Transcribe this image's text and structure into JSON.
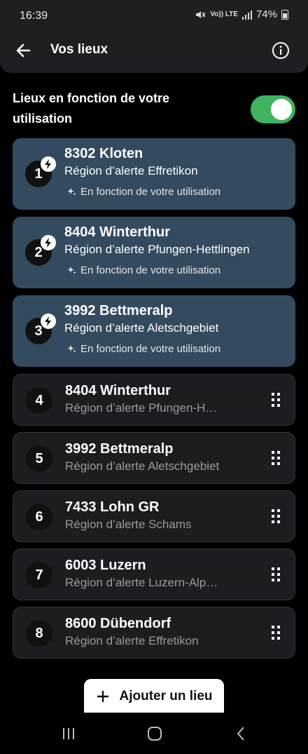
{
  "status": {
    "time": "16:39",
    "battery": "74%",
    "volte": "Vo)) LTE"
  },
  "header": {
    "title": "Vos lieux"
  },
  "setting": {
    "label": "Lieux en fonction de votre utilisation",
    "enabled": true,
    "toggle_color": "#3fb35f"
  },
  "auto_locations": [
    {
      "index": "1",
      "name": "8302 Kloten",
      "region": "Région d’alerte Effretikon",
      "usage": "En fonction de votre utilisation"
    },
    {
      "index": "2",
      "name": "8404 Winterthur",
      "region": "Région d’alerte Pfungen-Hettlingen",
      "usage": "En fonction de votre utilisation"
    },
    {
      "index": "3",
      "name": "3992 Bettmeralp",
      "region": "Région d’alerte Aletschgebiet",
      "usage": "En fonction de votre utilisation"
    }
  ],
  "saved_locations": [
    {
      "index": "4",
      "name": "8404 Winterthur",
      "region": "Région d’alerte Pfungen-H…"
    },
    {
      "index": "5",
      "name": "3992 Bettmeralp",
      "region": "Région d’alerte Aletschgebiet"
    },
    {
      "index": "6",
      "name": "7433 Lohn GR",
      "region": "Région d’alerte Schams"
    },
    {
      "index": "7",
      "name": "6003 Luzern",
      "region": "Région d’alerte Luzern-Alp…"
    },
    {
      "index": "8",
      "name": "8600 Dübendorf",
      "region": "Région d’alerte Effretikon"
    }
  ],
  "add_button": {
    "label": "Ajouter un lieu"
  },
  "colors": {
    "auto_card": "#344a5e",
    "saved_card": "#1c1d20",
    "background": "#000000"
  },
  "icons": {
    "back": "arrow-left-icon",
    "info": "info-icon",
    "bolt": "bolt-icon",
    "sparkle": "sparkle-icon",
    "drag": "drag-handle-icon",
    "plus": "plus-icon"
  }
}
